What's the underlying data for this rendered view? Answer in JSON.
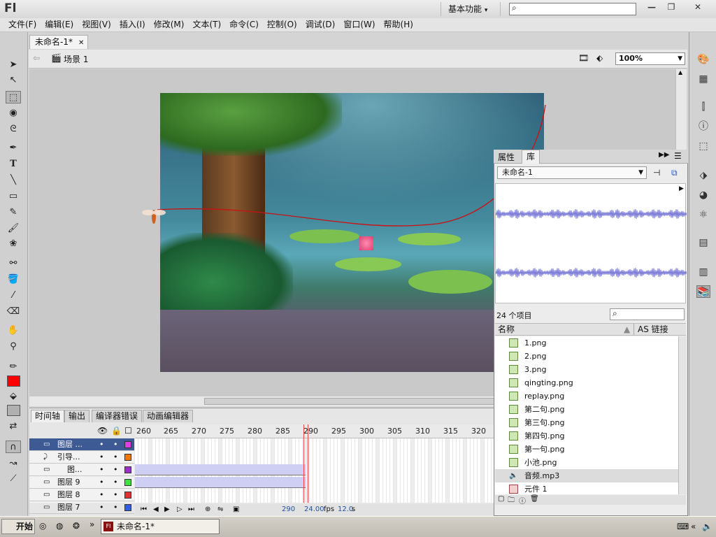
{
  "app": {
    "logo": "Fl",
    "workspace": "基本功能"
  },
  "window": {
    "minimize": "—",
    "restore": "❐",
    "close": "✕"
  },
  "menu": [
    "文件(F)",
    "编辑(E)",
    "视图(V)",
    "插入(I)",
    "修改(M)",
    "文本(T)",
    "命令(C)",
    "控制(O)",
    "调试(D)",
    "窗口(W)",
    "帮助(H)"
  ],
  "document": {
    "tab_label": "未命名-1*",
    "scene": "场景 1",
    "zoom": "100%"
  },
  "panel_tabs": [
    "时间轴",
    "输出",
    "编译器错误",
    "动画编辑器"
  ],
  "timeline": {
    "ruler": [
      "260",
      "265",
      "270",
      "275",
      "280",
      "285",
      "290",
      "295",
      "300",
      "305",
      "310",
      "315",
      "320"
    ],
    "layers": [
      {
        "name": "图层 ...",
        "color": "#e040e0"
      },
      {
        "name": "引导...",
        "color": "#f07800"
      },
      {
        "name": "图...",
        "color": "#9a30d0"
      },
      {
        "name": "图层 9",
        "color": "#40e040"
      },
      {
        "name": "图层 8",
        "color": "#e03030"
      },
      {
        "name": "图层 7",
        "color": "#3060e0"
      }
    ],
    "current_frame": "290",
    "fps": "24.00",
    "fps_unit": "fps",
    "seconds": "12.0",
    "seconds_unit": "s"
  },
  "library": {
    "tabs": [
      "属性",
      "库"
    ],
    "doc": "未命名-1",
    "count": "24 个项目",
    "col_name": "名称",
    "col_link": "AS 链接",
    "items": [
      "1.png",
      "2.png",
      "3.png",
      "qingting.png",
      "replay.png",
      "第二句.png",
      "第三句.png",
      "第四句.png",
      "第一句.png",
      "小池.png",
      "音频.mp3",
      "元件 1"
    ]
  },
  "taskbar": {
    "start": "开始",
    "task": "未命名-1*"
  },
  "colors": {
    "stroke": "#ff0000",
    "selected_layer": "#3d5a94"
  }
}
